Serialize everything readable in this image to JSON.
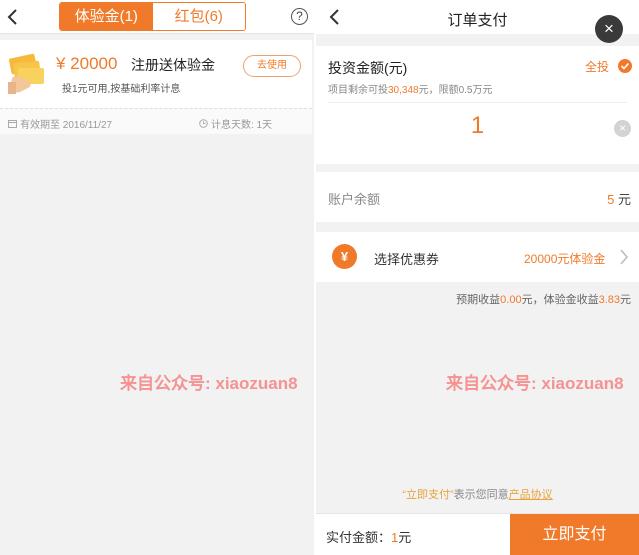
{
  "left": {
    "tabs": [
      {
        "label": "体验金(1)",
        "active": true
      },
      {
        "label": "红包(6)",
        "active": false
      }
    ],
    "help_label": "?",
    "card": {
      "amount": "¥ 20000",
      "title": "注册送体验金",
      "desc": "投1元可用,按基础利率计息",
      "use_label": "去使用",
      "expiry": "有效期至 2016/11/27",
      "days": "计息天数: 1天"
    },
    "watermark": "来自公众号: xiaozuan8"
  },
  "right": {
    "title": "订单支付",
    "close_label": "×",
    "invest": {
      "label": "投资金额(元)",
      "sub_prefix": "项目剩余可投",
      "sub_amount": "30,348",
      "sub_suffix": "元，限额0.5万元",
      "all_in": "全投",
      "value": "1",
      "clear": "×"
    },
    "balance": {
      "label": "账户余额",
      "value": "5",
      "unit": "元"
    },
    "coupon": {
      "icon": "¥",
      "label": "选择优惠券",
      "value": "20000元体验金"
    },
    "earnings": {
      "prefix": "预期收益",
      "expected": "0.00",
      "mid": "元，体验金收益",
      "bonus": "3.83",
      "unit": "元"
    },
    "watermark": "来自公众号: xiaozuan8",
    "agreement": {
      "quoted": "“立即支付”",
      "text": "表示您同意",
      "link": "产品协议"
    },
    "footer": {
      "pay_prefix": "实付金额：",
      "pay_amount": "1",
      "pay_unit": "元",
      "button": "立即支付"
    }
  },
  "colors": {
    "accent": "#f07a2a",
    "watermark": "#f59292",
    "background": "#f2f2f2"
  }
}
